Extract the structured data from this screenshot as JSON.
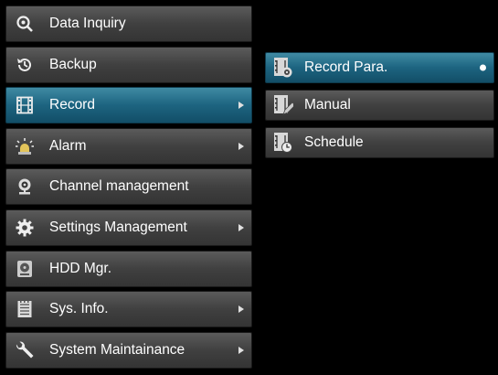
{
  "menu": {
    "items": [
      {
        "label": "Data Inquiry",
        "icon": "search-icon"
      },
      {
        "label": "Backup",
        "icon": "backup-icon"
      },
      {
        "label": "Record",
        "icon": "film-icon",
        "active": true,
        "has_submenu": true
      },
      {
        "label": "Alarm",
        "icon": "alarm-icon",
        "has_submenu": true
      },
      {
        "label": "Channel management",
        "icon": "camera-icon"
      },
      {
        "label": "Settings Management",
        "icon": "gear-icon",
        "has_submenu": true
      },
      {
        "label": "HDD Mgr.",
        "icon": "hdd-icon"
      },
      {
        "label": "Sys. Info.",
        "icon": "document-icon",
        "has_submenu": true
      },
      {
        "label": "System Maintainance",
        "icon": "wrench-icon",
        "has_submenu": true
      }
    ]
  },
  "submenu": {
    "items": [
      {
        "label": "Record Para.",
        "icon": "record-settings-icon",
        "active": true
      },
      {
        "label": "Manual",
        "icon": "manual-record-icon"
      },
      {
        "label": "Schedule",
        "icon": "schedule-icon"
      }
    ]
  },
  "colors": {
    "active": "#1d6480",
    "item": "#404040",
    "background": "#000000"
  }
}
